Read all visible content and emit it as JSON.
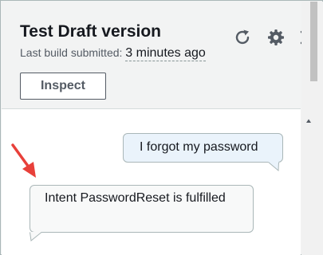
{
  "header": {
    "title": "Test Draft version",
    "subtitle_label": "Last build submitted:",
    "subtitle_value": "3 minutes ago",
    "inspect_label": "Inspect"
  },
  "icons": {
    "refresh": "refresh-icon",
    "settings": "gear-icon",
    "close": "close-icon"
  },
  "messages": [
    {
      "role": "user",
      "text": "I forgot my password"
    },
    {
      "role": "bot",
      "text": "Intent PasswordReset is fulfilled"
    }
  ],
  "colors": {
    "annotation_arrow": "#e8403a",
    "user_bubble": "#eaf3fb",
    "bot_bubble": "#f8f9f9"
  }
}
